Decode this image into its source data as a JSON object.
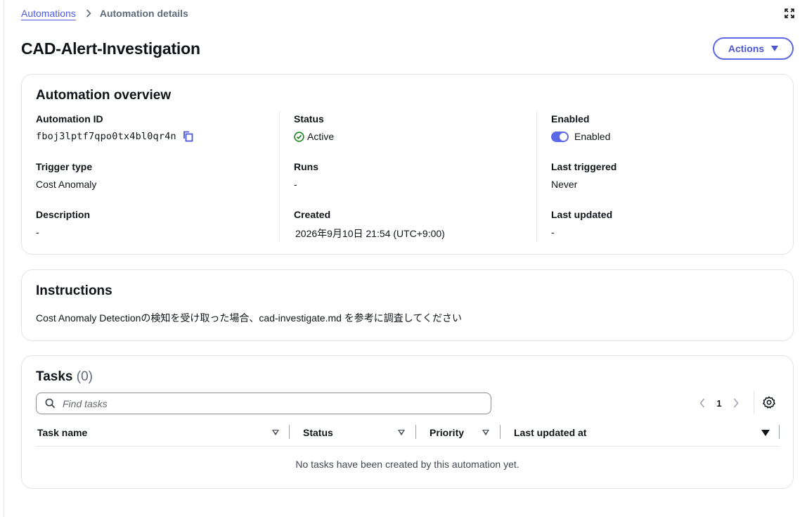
{
  "breadcrumb": {
    "parent": "Automations",
    "current": "Automation details"
  },
  "page": {
    "title": "CAD-Alert-Investigation",
    "actions_label": "Actions"
  },
  "overview": {
    "title": "Automation overview",
    "automation_id": {
      "label": "Automation ID",
      "value": "fboj3lptf7qpo0tx4bl0qr4n"
    },
    "status": {
      "label": "Status",
      "value": "Active"
    },
    "enabled": {
      "label": "Enabled",
      "value": "Enabled"
    },
    "trigger_type": {
      "label": "Trigger type",
      "value": "Cost Anomaly"
    },
    "runs": {
      "label": "Runs",
      "value": "-"
    },
    "last_triggered": {
      "label": "Last triggered",
      "value": "Never"
    },
    "description": {
      "label": "Description",
      "value": "-"
    },
    "created": {
      "label": "Created",
      "value": "2026年9月10日 21:54 (UTC+9:00)"
    },
    "last_updated": {
      "label": "Last updated",
      "value": "-"
    }
  },
  "instructions": {
    "title": "Instructions",
    "text": "Cost Anomaly Detectionの検知を受け取った場合、cad-investigate.md を参考に調査してください"
  },
  "tasks": {
    "title": "Tasks",
    "count": "(0)",
    "search_placeholder": "Find tasks",
    "page": "1",
    "columns": [
      "Task name",
      "Status",
      "Priority",
      "Last updated at"
    ],
    "empty_message": "No tasks have been created by this automation yet."
  },
  "colors": {
    "accent": "#5b67e6",
    "link": "#4b5ae0",
    "active": "#037f0c"
  }
}
